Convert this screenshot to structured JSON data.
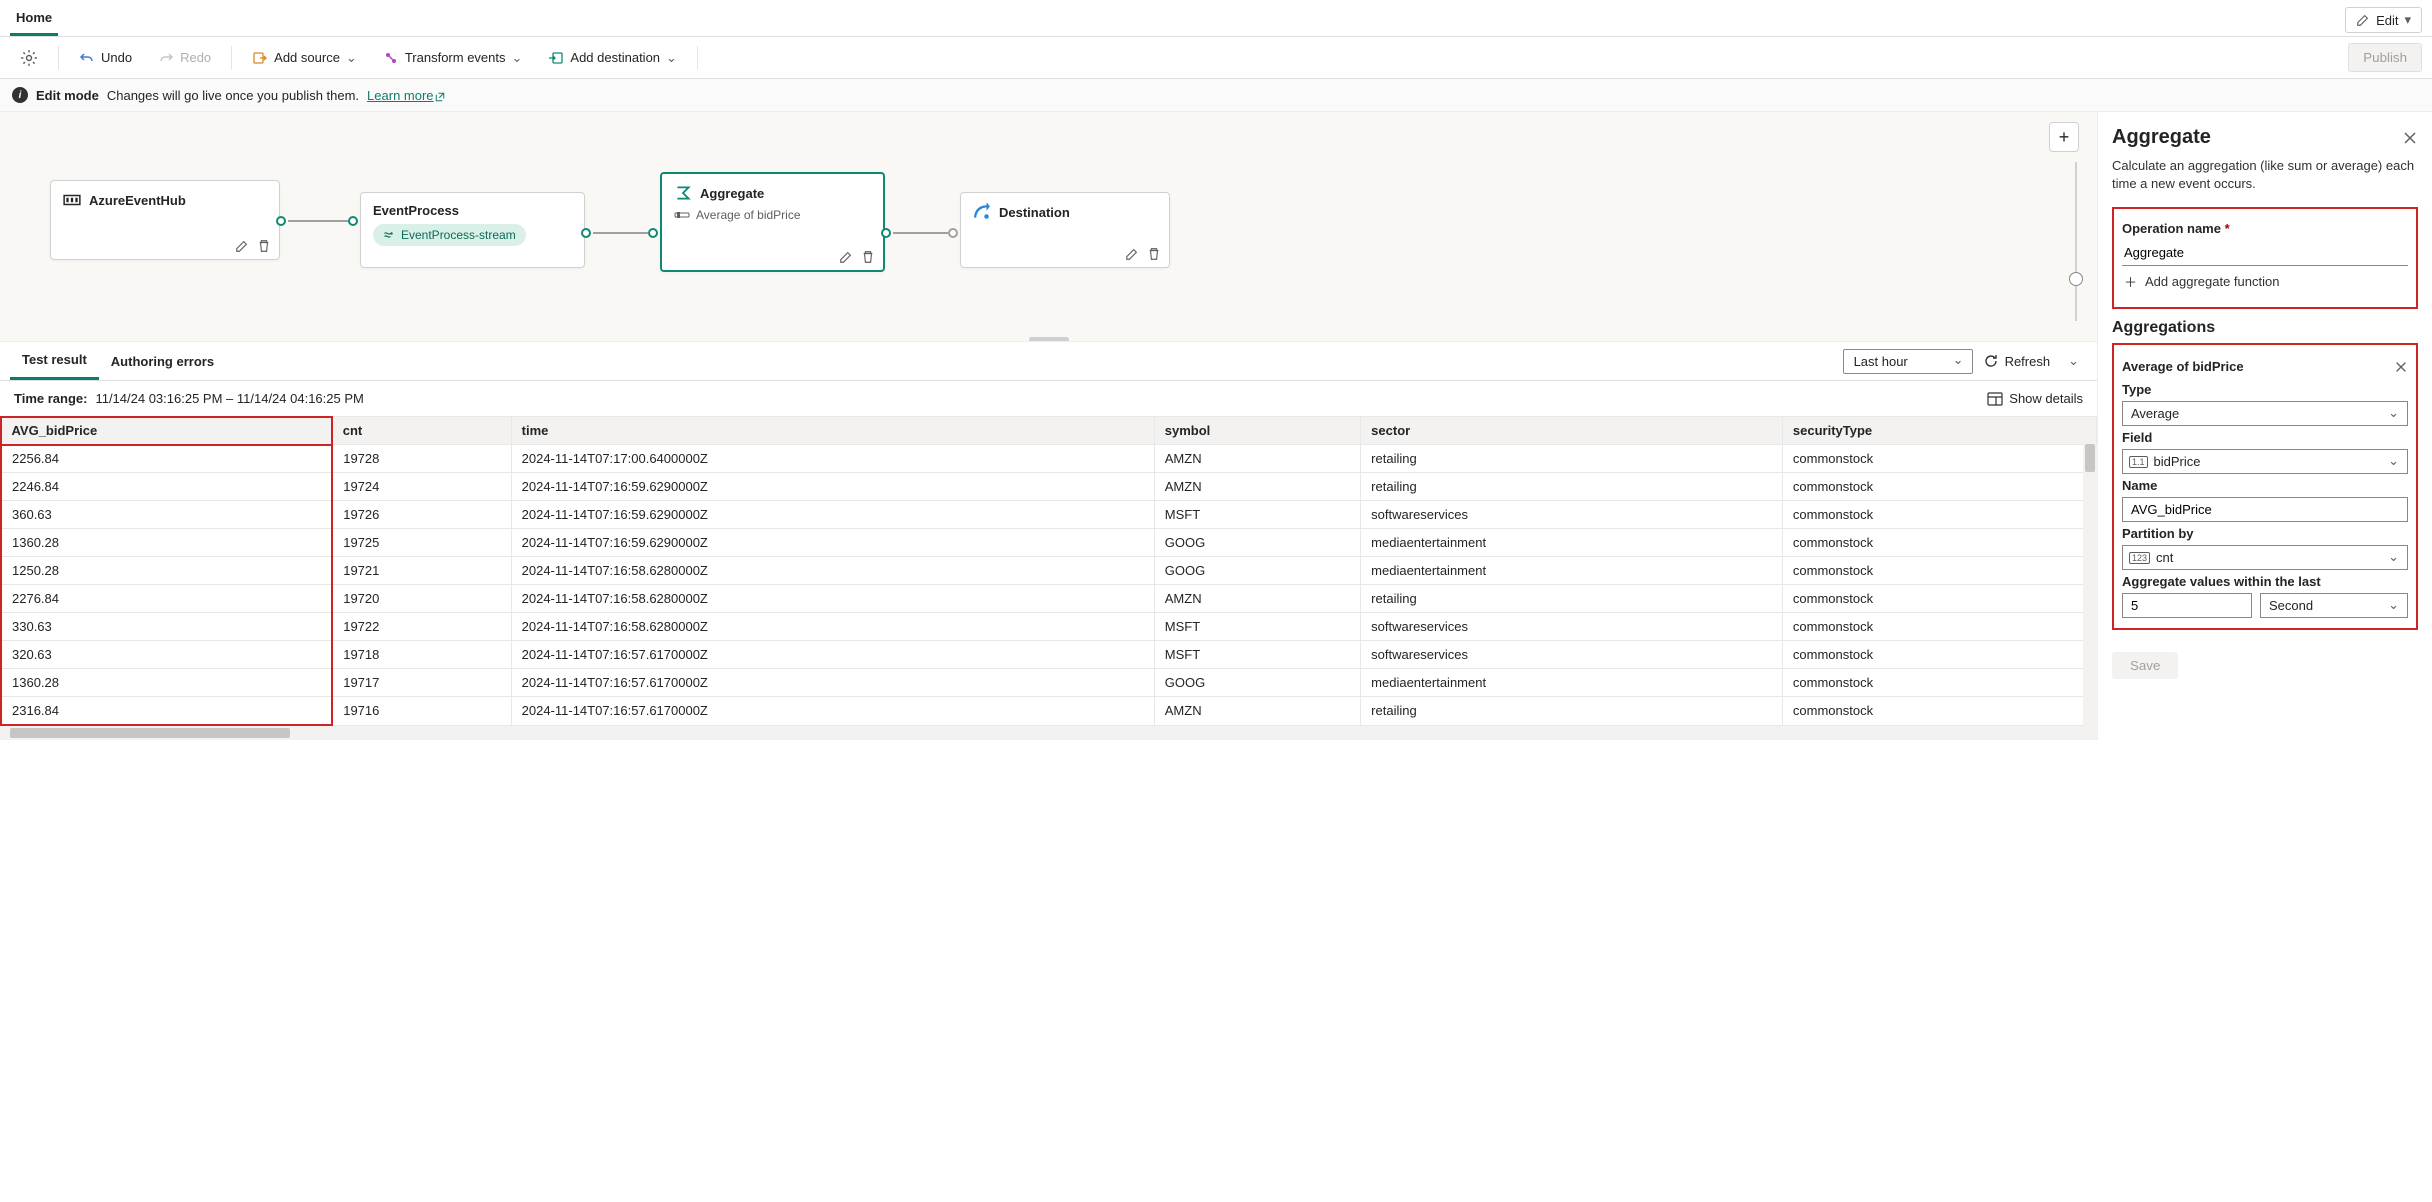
{
  "topbar": {
    "home": "Home",
    "edit": "Edit"
  },
  "toolbar": {
    "undo": "Undo",
    "redo": "Redo",
    "add_source": "Add source",
    "transform": "Transform events",
    "add_dest": "Add destination",
    "publish": "Publish"
  },
  "notice": {
    "mode": "Edit mode",
    "msg": "Changes will go live once you publish them.",
    "learn": "Learn more"
  },
  "nodes": {
    "source": {
      "title": "AzureEventHub"
    },
    "process": {
      "title": "EventProcess",
      "stream": "EventProcess-stream"
    },
    "aggregate": {
      "title": "Aggregate",
      "sub": "Average of bidPrice"
    },
    "dest": {
      "title": "Destination"
    }
  },
  "results": {
    "tab_test": "Test result",
    "tab_err": "Authoring errors",
    "range_label": "Last hour",
    "refresh": "Refresh",
    "time_range_label": "Time range:",
    "time_range_value": "11/14/24 03:16:25 PM – 11/14/24 04:16:25 PM",
    "show_details": "Show details",
    "columns": [
      "AVG_bidPrice",
      "cnt",
      "time",
      "symbol",
      "sector",
      "securityType"
    ],
    "rows": [
      [
        "2256.84",
        "19728",
        "2024-11-14T07:17:00.6400000Z",
        "AMZN",
        "retailing",
        "commonstock"
      ],
      [
        "2246.84",
        "19724",
        "2024-11-14T07:16:59.6290000Z",
        "AMZN",
        "retailing",
        "commonstock"
      ],
      [
        "360.63",
        "19726",
        "2024-11-14T07:16:59.6290000Z",
        "MSFT",
        "softwareservices",
        "commonstock"
      ],
      [
        "1360.28",
        "19725",
        "2024-11-14T07:16:59.6290000Z",
        "GOOG",
        "mediaentertainment",
        "commonstock"
      ],
      [
        "1250.28",
        "19721",
        "2024-11-14T07:16:58.6280000Z",
        "GOOG",
        "mediaentertainment",
        "commonstock"
      ],
      [
        "2276.84",
        "19720",
        "2024-11-14T07:16:58.6280000Z",
        "AMZN",
        "retailing",
        "commonstock"
      ],
      [
        "330.63",
        "19722",
        "2024-11-14T07:16:58.6280000Z",
        "MSFT",
        "softwareservices",
        "commonstock"
      ],
      [
        "320.63",
        "19718",
        "2024-11-14T07:16:57.6170000Z",
        "MSFT",
        "softwareservices",
        "commonstock"
      ],
      [
        "1360.28",
        "19717",
        "2024-11-14T07:16:57.6170000Z",
        "GOOG",
        "mediaentertainment",
        "commonstock"
      ],
      [
        "2316.84",
        "19716",
        "2024-11-14T07:16:57.6170000Z",
        "AMZN",
        "retailing",
        "commonstock"
      ]
    ]
  },
  "panel": {
    "title": "Aggregate",
    "desc": "Calculate an aggregation (like sum or average) each time a new event occurs.",
    "op_label": "Operation name",
    "op_value": "Aggregate",
    "add_fn": "Add aggregate function",
    "aggs_h": "Aggregations",
    "agg_title": "Average of bidPrice",
    "type_label": "Type",
    "type_value": "Average",
    "field_label": "Field",
    "field_value": "bidPrice",
    "name_label": "Name",
    "name_value": "AVG_bidPrice",
    "partition_label": "Partition by",
    "partition_value": "cnt",
    "window_label": "Aggregate values within the last",
    "window_num": "5",
    "window_unit": "Second",
    "save": "Save"
  }
}
